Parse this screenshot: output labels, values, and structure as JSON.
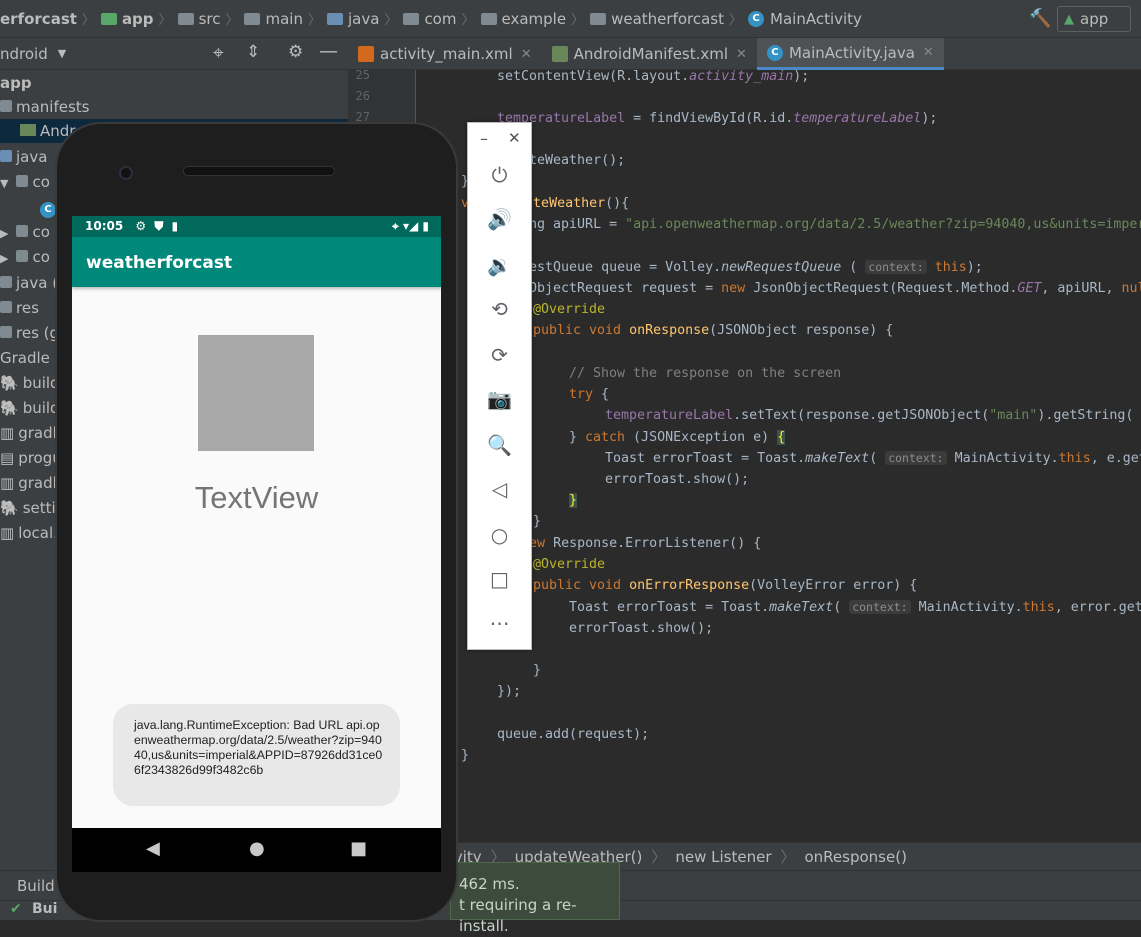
{
  "navbar": {
    "crumbs": [
      "erforcast",
      "app",
      "src",
      "main",
      "java",
      "com",
      "example",
      "weatherforcast",
      "MainActivity"
    ],
    "run_config": "app"
  },
  "project": {
    "view_selector": "ndroid",
    "tree": [
      {
        "label": "app",
        "bold": true
      },
      {
        "label": "manifests"
      },
      {
        "label": "Andr"
      },
      {
        "label": "java"
      },
      {
        "label": "co"
      },
      {
        "label": ""
      },
      {
        "label": "co"
      },
      {
        "label": "co"
      },
      {
        "label": "java ("
      },
      {
        "label": "res"
      },
      {
        "label": "res (g"
      },
      {
        "label": "Gradle Sc"
      },
      {
        "label": "build."
      },
      {
        "label": "build."
      },
      {
        "label": "gradle"
      },
      {
        "label": "progu"
      },
      {
        "label": "gradle"
      },
      {
        "label": "settin"
      },
      {
        "label": "local.p"
      }
    ]
  },
  "editor": {
    "tabs": [
      {
        "label": "activity_main.xml",
        "icon_color": "#d2691e"
      },
      {
        "label": "AndroidManifest.xml",
        "icon_color": "#6a8759"
      },
      {
        "label": "MainActivity.java",
        "icon_color": "#3592c4",
        "active": true
      }
    ],
    "line_numbers": [
      "25",
      "26",
      "27"
    ],
    "breadcrumbs": [
      "nActivity",
      "updateWeather()",
      "new Listener",
      "onResponse()"
    ]
  },
  "bottom": {
    "build_tab": "Build",
    "build_status": "Bui",
    "toast_line1": "462 ms.",
    "toast_line2": "t requiring a re-install."
  },
  "emulator": {
    "status_time": "10:05",
    "app_title": "weatherforcast",
    "textview": "TextView",
    "toast": "java.lang.RuntimeException: Bad URL api.openweathermap.org/data/2.5/weather?zip=94040,us&units=imperial&APPID=87926dd31ce06f2343826d99f3482c6b"
  }
}
